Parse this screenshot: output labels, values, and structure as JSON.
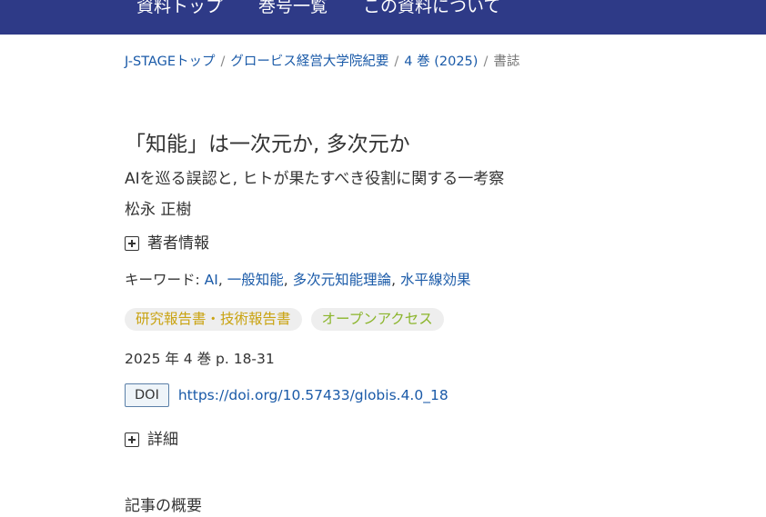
{
  "topnav": {
    "items": [
      {
        "label": "資料トップ"
      },
      {
        "label": "巻号一覧"
      },
      {
        "label": "この資料について"
      }
    ]
  },
  "breadcrumb": {
    "items": [
      {
        "label": "J-STAGEトップ"
      },
      {
        "label": "グロービス経営大学院紀要"
      },
      {
        "label": "4 巻 (2025)"
      }
    ],
    "current": "書誌"
  },
  "article": {
    "title": "「知能」は一次元か, 多次元か",
    "subtitle": "AIを巡る誤認と, ヒトが果たすべき役割に関する一考察",
    "author": "松永 正樹",
    "author_info_label": "著者情報",
    "keywords_label": "キーワード:",
    "keywords": [
      "AI",
      "一般知能",
      "多次元知能理論",
      "水平線効果"
    ],
    "badges": [
      {
        "label": "研究報告書・技術報告書",
        "color": "#c9a311"
      },
      {
        "label": "オープンアクセス",
        "color": "#8bb52b"
      }
    ],
    "volume_info": "2025 年 4 巻 p. 18-31",
    "doi_label": "DOI",
    "doi_url": "https://doi.org/10.57433/globis.4.0_18",
    "details_label": "詳細",
    "abstract_heading": "記事の概要"
  },
  "colors": {
    "nav_bg": "#2e3a87",
    "link": "#1a5aa8"
  }
}
